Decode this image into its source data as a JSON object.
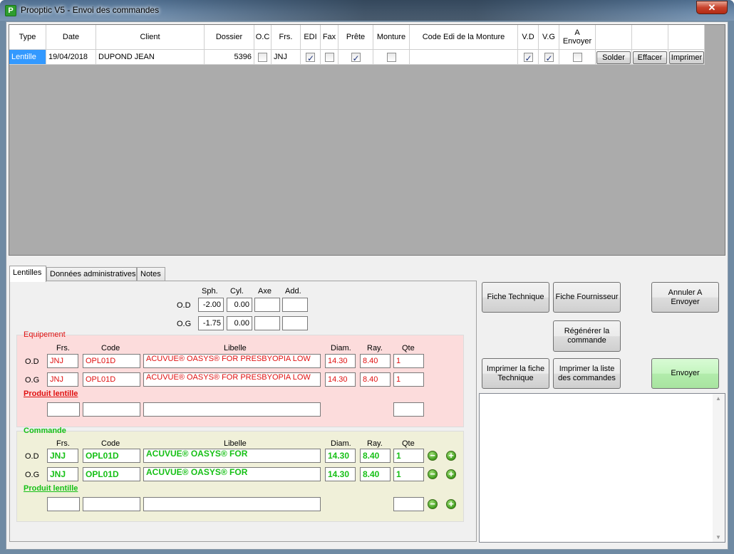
{
  "window": {
    "title": "Prooptic V5 - Envoi des commandes",
    "close_glyph": "✕",
    "app_icon_letter": "P"
  },
  "grid": {
    "headers": [
      "Type",
      "Date",
      "Client",
      "Dossier",
      "O.C",
      "Frs.",
      "EDI",
      "Fax",
      "Prête",
      "Monture",
      "Code Edi de la Monture",
      "V.D",
      "V.G",
      "A Envoyer"
    ],
    "row": {
      "type": "Lentille",
      "date": "19/04/2018",
      "client": "DUPOND JEAN",
      "dossier": "5396",
      "oc": false,
      "frs": "JNJ",
      "edi": true,
      "fax": false,
      "prete": true,
      "monture": false,
      "code_edi_monture": "",
      "vd": true,
      "vg": true,
      "a_envoyer": false,
      "solder": "Solder",
      "effacer": "Effacer",
      "imprimer": "Imprimer"
    }
  },
  "tabs": [
    "Lentilles",
    "Données administratives",
    "Notes"
  ],
  "prescription": {
    "headers": {
      "sph": "Sph.",
      "cyl": "Cyl.",
      "axe": "Axe",
      "add": "Add."
    },
    "od": {
      "label": "O.D",
      "sph": "-2.00",
      "cyl": "0.00",
      "axe": "",
      "add": ""
    },
    "og": {
      "label": "O.G",
      "sph": "-1.75",
      "cyl": "0.00",
      "axe": "",
      "add": ""
    }
  },
  "equipement": {
    "caption": "Equipement",
    "headers": {
      "frs": "Frs.",
      "code": "Code",
      "libelle": "Libelle",
      "diam": "Diam.",
      "ray": "Ray.",
      "qte": "Qte"
    },
    "od": {
      "label": "O.D",
      "frs": "JNJ",
      "code": "OPL01D",
      "libelle": "ACUVUE® OASYS® FOR PRESBYOPIA LOW",
      "diam": "14.30",
      "ray": "8.40",
      "qte": "1"
    },
    "og": {
      "label": "O.G",
      "frs": "JNJ",
      "code": "OPL01D",
      "libelle": "ACUVUE® OASYS® FOR PRESBYOPIA LOW",
      "diam": "14.30",
      "ray": "8.40",
      "qte": "1"
    },
    "produit_label": "Produit lentille",
    "produit": {
      "frs": "",
      "code": "",
      "libelle": "",
      "qte": ""
    }
  },
  "commande": {
    "caption": "Commande",
    "headers": {
      "frs": "Frs.",
      "code": "Code",
      "libelle": "Libelle",
      "diam": "Diam.",
      "ray": "Ray.",
      "qte": "Qte"
    },
    "od": {
      "label": "O.D",
      "frs": "JNJ",
      "code": "OPL01D",
      "libelle": "ACUVUE® OASYS® FOR",
      "diam": "14.30",
      "ray": "8.40",
      "qte": "1"
    },
    "og": {
      "label": "O.G",
      "frs": "JNJ",
      "code": "OPL01D",
      "libelle": "ACUVUE® OASYS® FOR",
      "diam": "14.30",
      "ray": "8.40",
      "qte": "1"
    },
    "produit_label": "Produit lentille",
    "produit": {
      "frs": "",
      "code": "",
      "libelle": "",
      "qte": ""
    },
    "minus_glyph": "−",
    "plus_glyph": "+"
  },
  "buttons": {
    "fiche_technique": "Fiche Technique",
    "fiche_fournisseur": "Fiche Fournisseur",
    "annuler": "Annuler A Envoyer",
    "regenerer": "Régénérer la commande",
    "imprimer_fiche": "Imprimer la fiche Technique",
    "imprimer_liste": "Imprimer la liste des commandes",
    "envoyer": "Envoyer"
  },
  "memo": {
    "text": "",
    "scroll_up": "▲",
    "scroll_down": "▼"
  },
  "colors": {
    "equipement_bg": "#fcdcdc",
    "commande_bg": "#f0f0d9",
    "equipement_text": "#e01010",
    "commande_text": "#16c016",
    "selected_row": "#3399ff"
  }
}
